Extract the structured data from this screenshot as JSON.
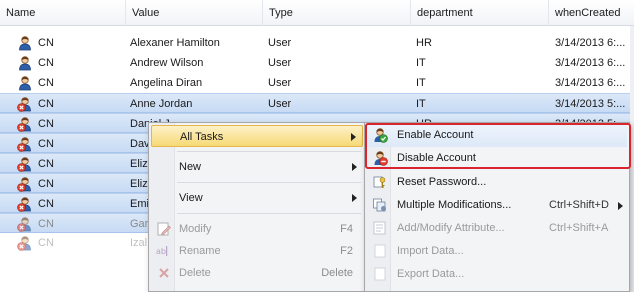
{
  "columns": {
    "name": "Name",
    "value": "Value",
    "type": "Type",
    "department": "department",
    "whenCreated": "whenCreated"
  },
  "rows": [
    {
      "cn": "CN",
      "value": "Alexaner Hamilton",
      "type": "User",
      "department": "HR",
      "whenCreated": "3/14/2013 6:..."
    },
    {
      "cn": "CN",
      "value": "Andrew Wilson",
      "type": "User",
      "department": "IT",
      "whenCreated": "3/14/2013 6:..."
    },
    {
      "cn": "CN",
      "value": "Angelina Diran",
      "type": "User",
      "department": "IT",
      "whenCreated": "3/14/2013 6:..."
    },
    {
      "cn": "CN",
      "value": "Anne Jordan",
      "type": "User",
      "department": "IT",
      "whenCreated": "3/14/2013 5:..."
    },
    {
      "cn": "CN",
      "value": "Daniel J...",
      "type": "",
      "department": "HR",
      "whenCreated": "3/14/2013 5:..."
    },
    {
      "cn": "CN",
      "value": "Dav",
      "type": "",
      "department": "",
      "whenCreated": ""
    },
    {
      "cn": "CN",
      "value": "Eliza",
      "type": "",
      "department": "",
      "whenCreated": ""
    },
    {
      "cn": "CN",
      "value": "Eliza",
      "type": "",
      "department": "",
      "whenCreated": ""
    },
    {
      "cn": "CN",
      "value": "Emi",
      "type": "",
      "department": "",
      "whenCreated": ""
    },
    {
      "cn": "CN",
      "value": "Gar",
      "type": "",
      "department": "",
      "whenCreated": ""
    },
    {
      "cn": "CN",
      "value": "Izal",
      "type": "",
      "department": "",
      "whenCreated": ""
    }
  ],
  "context_menu": {
    "all_tasks": "All Tasks",
    "new": "New",
    "view": "View",
    "modify": "Modify",
    "modify_shortcut": "F4",
    "rename": "Rename",
    "rename_shortcut": "F2",
    "delete": "Delete",
    "delete_shortcut": "Delete"
  },
  "submenu": {
    "enable_account": "Enable Account",
    "disable_account": "Disable Account",
    "reset_password": "Reset Password...",
    "multiple_modifications": "Multiple Modifications...",
    "multiple_modifications_shortcut": "Ctrl+Shift+D",
    "add_modify_attribute": "Add/Modify Attribute...",
    "add_modify_attribute_shortcut": "Ctrl+Shift+A",
    "import_data": "Import Data...",
    "export_data": "Export Data..."
  },
  "colors": {
    "selection": "#c7dbf4",
    "menu_highlight": "#f6d976",
    "callout_border": "#d8262e"
  },
  "icons": {
    "user": "user-icon",
    "disabled_user": "disabled-user-icon",
    "enable": "enable-account-icon",
    "disable": "disable-account-icon",
    "password": "key-icon",
    "multi": "multiple-modifications-icon",
    "attribute": "attribute-icon",
    "import": "import-icon",
    "export": "export-icon",
    "modify": "modify-icon",
    "rename": "rename-icon",
    "delete": "delete-icon"
  }
}
